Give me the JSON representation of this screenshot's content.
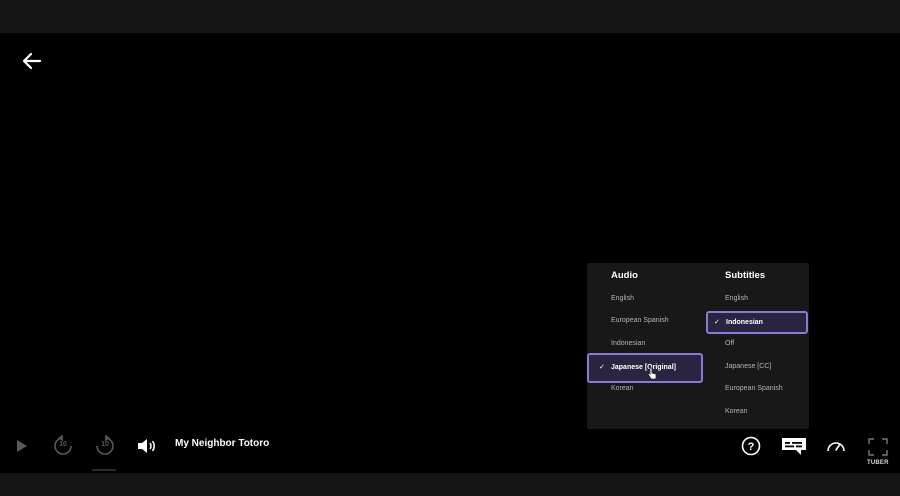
{
  "player": {
    "title": "My Neighbor Totoro",
    "watermark": "TUBER"
  },
  "panel": {
    "audio": {
      "title": "Audio",
      "options": [
        "English",
        "European Spanish",
        "Indonesian",
        "Japanese [Original]",
        "Korean"
      ],
      "selected": "Japanese [Original]"
    },
    "subtitles": {
      "title": "Subtitles",
      "options": [
        "English",
        "Indonesian",
        "Off",
        "Japanese [CC]",
        "European Spanish",
        "Korean"
      ],
      "selected": "Indonesian"
    },
    "check_mark": "✓"
  },
  "controls": {
    "rewind_seconds": "10",
    "forward_seconds": "10"
  },
  "icons": {
    "back": "back-arrow-icon",
    "play": "play-icon",
    "rewind": "rewind-10-icon",
    "forward": "forward-10-icon",
    "volume": "volume-icon",
    "help": "help-icon",
    "subtitles": "subtitles-icon",
    "speed": "speed-icon",
    "fullscreen": "fullscreen-icon"
  },
  "colors": {
    "background": "#000000",
    "bars": "#141414",
    "panel": "#181818",
    "selection_border": "#8b79d6",
    "muted_text": "#b3b3b3"
  }
}
